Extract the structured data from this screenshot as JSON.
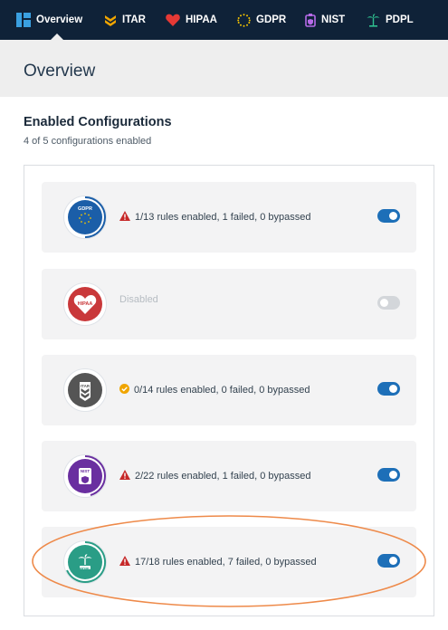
{
  "nav": {
    "tabs": [
      {
        "label": "Overview",
        "icon": "overview-icon",
        "active": true
      },
      {
        "label": "ITAR",
        "icon": "itar-icon"
      },
      {
        "label": "HIPAA",
        "icon": "heart-icon"
      },
      {
        "label": "GDPR",
        "icon": "gdpr-stars-icon"
      },
      {
        "label": "NIST",
        "icon": "nist-icon"
      },
      {
        "label": "PDPL",
        "icon": "palm-icon"
      }
    ]
  },
  "header": {
    "title": "Overview"
  },
  "section": {
    "title": "Enabled Configurations",
    "subtitle": "4 of 5 configurations enabled"
  },
  "configs": [
    {
      "name": "GDPR",
      "badge_label": "GDPR",
      "status": "1/13 rules enabled, 1 failed, 0 bypassed",
      "status_icon": "warning-icon",
      "enabled": true,
      "color": "#1b5ea8"
    },
    {
      "name": "HIPAA",
      "badge_label": "HIPAA",
      "status": "Disabled",
      "status_icon": "",
      "enabled": false,
      "color": "#c9383a"
    },
    {
      "name": "ITAR",
      "badge_label": "ITAR",
      "status": "0/14 rules enabled, 0 failed, 0 bypassed",
      "status_icon": "check-circle-icon",
      "enabled": true,
      "color": "#555555"
    },
    {
      "name": "NIST",
      "badge_label": "NIST",
      "status": "2/22 rules enabled, 1 failed, 0 bypassed",
      "status_icon": "warning-icon",
      "enabled": true,
      "color": "#6a2fa0"
    },
    {
      "name": "PDPL",
      "badge_label": "PDPL",
      "status": "17/18 rules enabled, 7 failed, 0 bypassed",
      "status_icon": "warning-icon",
      "enabled": true,
      "color": "#2a9d86"
    }
  ],
  "colors": {
    "nav_bg": "#0f2238",
    "toggle_on": "#1d6fb8",
    "warning": "#c62828",
    "ok": "#f0a500",
    "highlight": "#ee8a4a"
  }
}
